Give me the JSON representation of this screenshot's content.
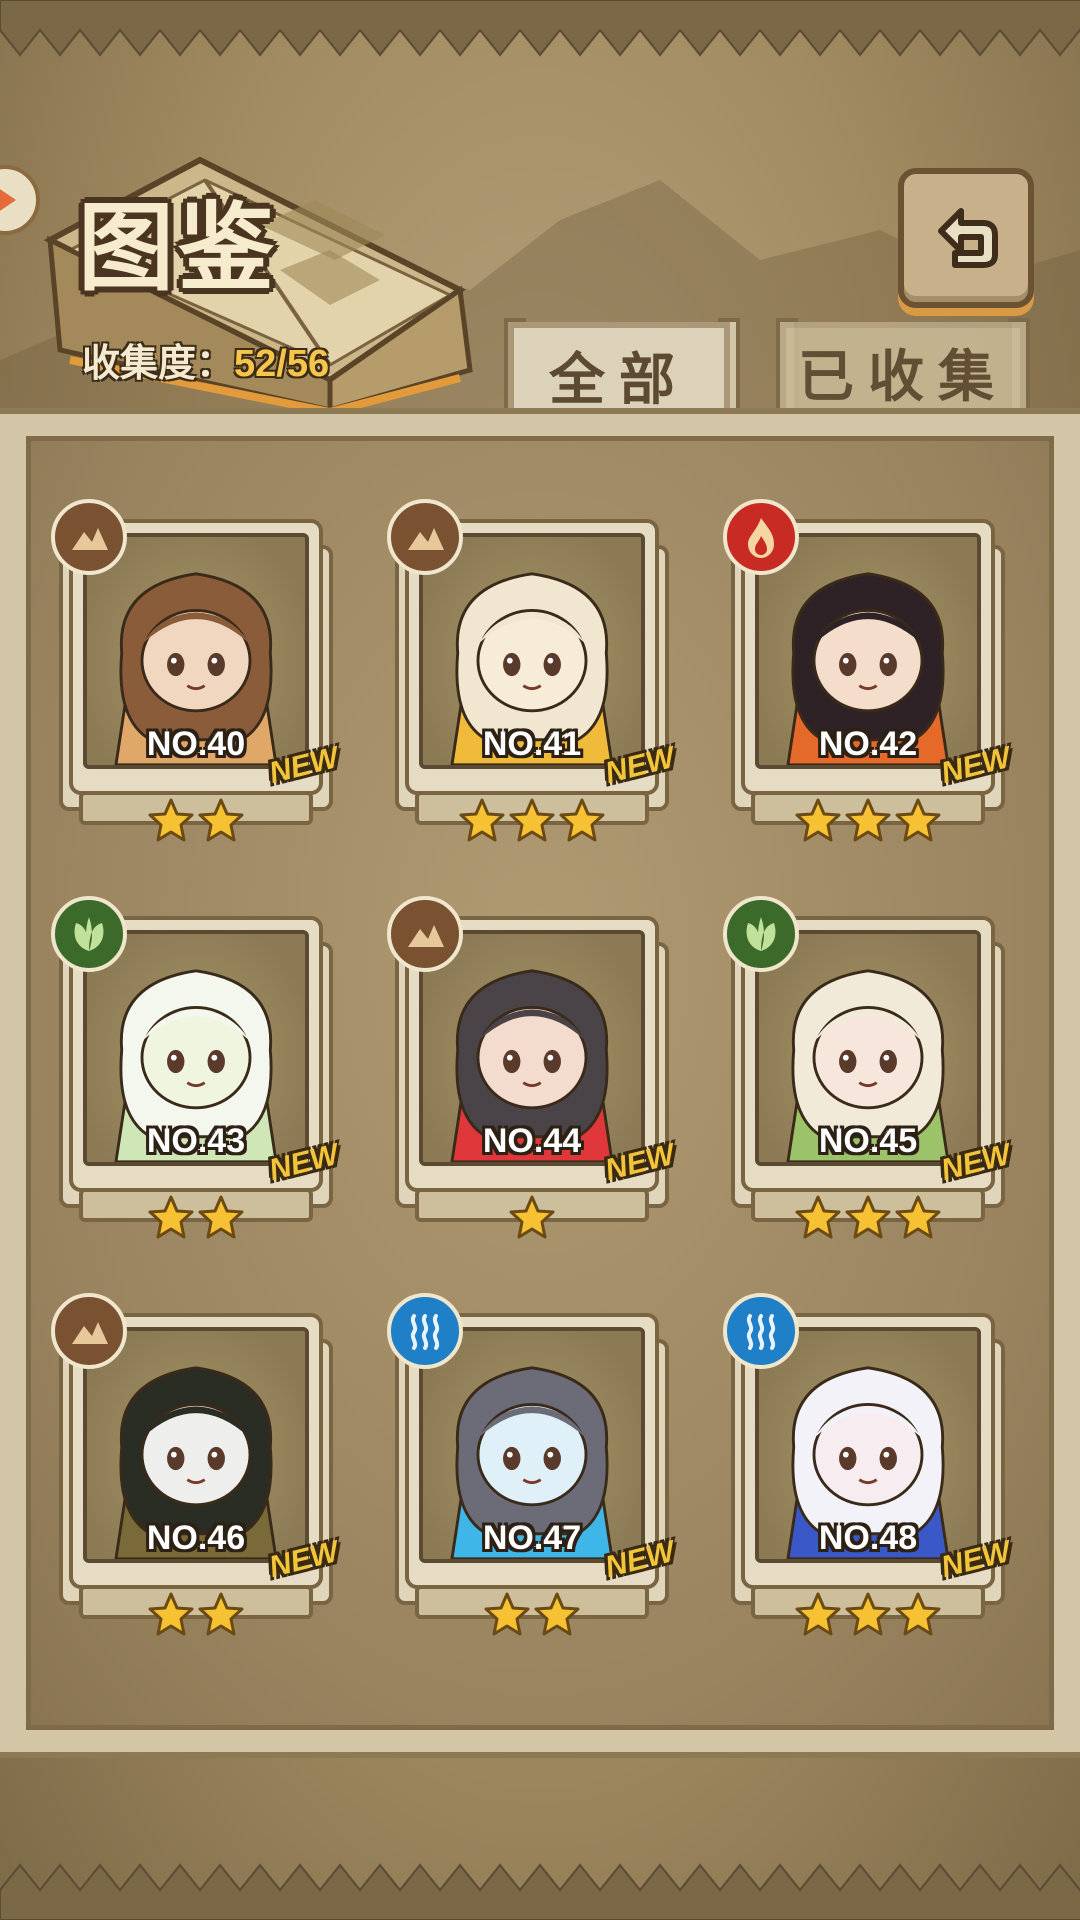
{
  "header": {
    "title": "图鉴",
    "collect_label": "收集度：",
    "collect_value": "52/56"
  },
  "tabs": [
    {
      "label": "全部",
      "active": true
    },
    {
      "label": "已收集",
      "active": false
    }
  ],
  "colors": {
    "collect_value": "#f6c64a",
    "new_badge": "#f2c43a",
    "star": "#f6c233",
    "earth": "#7a5232",
    "fire": "#c82a24",
    "leaf": "#3b6a2a",
    "water": "#1f7fc7"
  },
  "cards": [
    {
      "no": "NO.40",
      "new": "NEW",
      "stars": 2,
      "element": "earth-icon",
      "palette": [
        "#8a5c3a",
        "#f2d7c0",
        "#e0a868"
      ]
    },
    {
      "no": "NO.41",
      "new": "NEW",
      "stars": 3,
      "element": "earth-icon",
      "palette": [
        "#f1e6cf",
        "#f7ecd8",
        "#f0bb3a"
      ]
    },
    {
      "no": "NO.42",
      "new": "NEW",
      "stars": 3,
      "element": "fire-icon",
      "palette": [
        "#2e2226",
        "#f5ddcc",
        "#e56a2a"
      ]
    },
    {
      "no": "NO.43",
      "new": "NEW",
      "stars": 2,
      "element": "leaf-icon",
      "palette": [
        "#f4f7ee",
        "#eff5df",
        "#cfe6b6"
      ]
    },
    {
      "no": "NO.44",
      "new": "NEW",
      "stars": 1,
      "element": "earth-icon",
      "palette": [
        "#4a4448",
        "#f3dccd",
        "#e0383a"
      ]
    },
    {
      "no": "NO.45",
      "new": "NEW",
      "stars": 3,
      "element": "leaf-icon",
      "palette": [
        "#f2ead8",
        "#f7e6dc",
        "#9cc36a"
      ]
    },
    {
      "no": "NO.46",
      "new": "NEW",
      "stars": 2,
      "element": "earth-icon",
      "palette": [
        "#2a2d24",
        "#eeeeec",
        "#7a6a3a"
      ]
    },
    {
      "no": "NO.47",
      "new": "NEW",
      "stars": 2,
      "element": "water-icon",
      "palette": [
        "#6b6c78",
        "#dff0f8",
        "#3fb6e8"
      ]
    },
    {
      "no": "NO.48",
      "new": "NEW",
      "stars": 3,
      "element": "water-icon",
      "palette": [
        "#f2f2f8",
        "#f7ecf0",
        "#3a58c8"
      ]
    }
  ]
}
